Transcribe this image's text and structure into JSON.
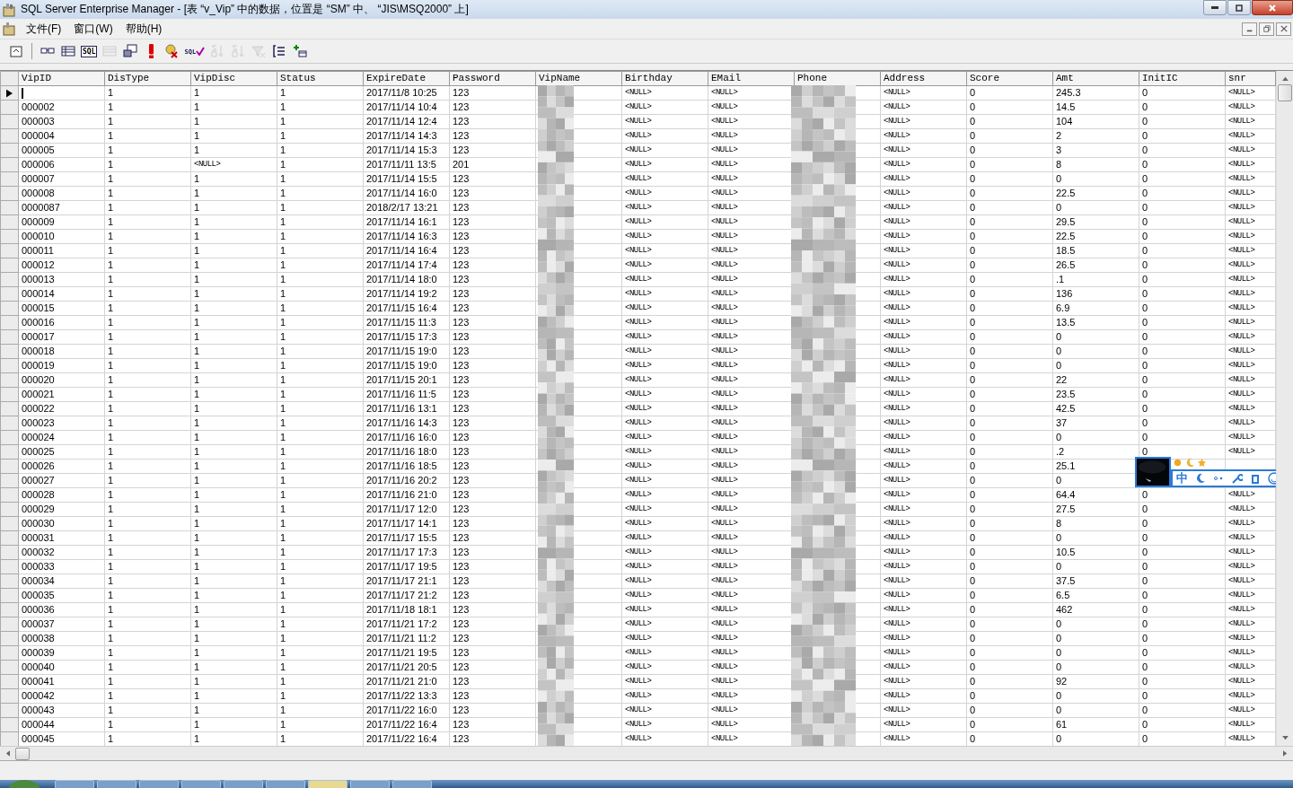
{
  "window": {
    "title": "SQL Server Enterprise Manager - [表 “v_Vip” 中的数据，位置是 “SM” 中、 “JIS\\MSQ2000” 上]"
  },
  "menu": [
    "文件(F)",
    "窗口(W)",
    "帮助(H)"
  ],
  "toolbar": [
    {
      "kind": "properties",
      "disabled": false
    },
    {
      "kind": "separator"
    },
    {
      "kind": "diagram",
      "disabled": false
    },
    {
      "kind": "grid",
      "disabled": false
    },
    {
      "kind": "sql",
      "text": "SQL",
      "disabled": false
    },
    {
      "kind": "results",
      "disabled": true
    },
    {
      "kind": "change-type",
      "disabled": false
    },
    {
      "kind": "run",
      "disabled": false
    },
    {
      "kind": "cancel",
      "disabled": false
    },
    {
      "kind": "verify",
      "text": "SQL",
      "disabled": false
    },
    {
      "kind": "sort-asc",
      "disabled": true
    },
    {
      "kind": "sort-desc",
      "disabled": true
    },
    {
      "kind": "remove-filter",
      "disabled": true
    },
    {
      "kind": "group-by",
      "disabled": false
    },
    {
      "kind": "add-table",
      "disabled": false
    }
  ],
  "table": {
    "columns": [
      "VipID",
      "DisType",
      "VipDisc",
      "Status",
      "ExpireDate",
      "Password",
      "VipName",
      "Birthday",
      "EMail",
      "Phone",
      "Address",
      "Score",
      "Amt",
      "InitIC",
      "snr"
    ],
    "rows": [
      {
        "current": true,
        "cells": [
          null,
          "1",
          "1",
          "1",
          "2017/11/8 10:25",
          "123",
          null,
          "<NULL>",
          "<NULL>",
          null,
          "<NULL>",
          "0",
          "245.3",
          "0",
          "<NULL>"
        ]
      },
      {
        "current": false,
        "cells": [
          "000002",
          "1",
          "1",
          "1",
          "2017/11/14 10:4",
          "123",
          null,
          "<NULL>",
          "<NULL>",
          null,
          "<NULL>",
          "0",
          "14.5",
          "0",
          "<NULL>"
        ]
      },
      {
        "current": false,
        "cells": [
          "000003",
          "1",
          "1",
          "1",
          "2017/11/14 12:4",
          "123",
          null,
          "<NULL>",
          "<NULL>",
          null,
          "<NULL>",
          "0",
          "104",
          "0",
          "<NULL>"
        ]
      },
      {
        "current": false,
        "cells": [
          "000004",
          "1",
          "1",
          "1",
          "2017/11/14 14:3",
          "123",
          null,
          "<NULL>",
          "<NULL>",
          null,
          "<NULL>",
          "0",
          "2",
          "0",
          "<NULL>"
        ]
      },
      {
        "current": false,
        "cells": [
          "000005",
          "1",
          "1",
          "1",
          "2017/11/14 15:3",
          "123",
          null,
          "<NULL>",
          "<NULL>",
          null,
          "<NULL>",
          "0",
          "3",
          "0",
          "<NULL>"
        ]
      },
      {
        "current": false,
        "cells": [
          "000006",
          "1",
          "<NULL>",
          "1",
          "2017/11/11 13:5",
          "201",
          null,
          "<NULL>",
          "<NULL>",
          null,
          "<NULL>",
          "0",
          "8",
          "0",
          "<NULL>"
        ]
      },
      {
        "current": false,
        "cells": [
          "000007",
          "1",
          "1",
          "1",
          "2017/11/14 15:5",
          "123",
          null,
          "<NULL>",
          "<NULL>",
          null,
          "<NULL>",
          "0",
          "0",
          "0",
          "<NULL>"
        ]
      },
      {
        "current": false,
        "cells": [
          "000008",
          "1",
          "1",
          "1",
          "2017/11/14 16:0",
          "123",
          null,
          "<NULL>",
          "<NULL>",
          null,
          "<NULL>",
          "0",
          "22.5",
          "0",
          "<NULL>"
        ]
      },
      {
        "current": false,
        "cells": [
          "0000087",
          "1",
          "1",
          "1",
          "2018/2/17 13:21",
          "123",
          null,
          "<NULL>",
          "<NULL>",
          null,
          "<NULL>",
          "0",
          "0",
          "0",
          "<NULL>"
        ]
      },
      {
        "current": false,
        "cells": [
          "000009",
          "1",
          "1",
          "1",
          "2017/11/14 16:1",
          "123",
          null,
          "<NULL>",
          "<NULL>",
          null,
          "<NULL>",
          "0",
          "29.5",
          "0",
          "<NULL>"
        ]
      },
      {
        "current": false,
        "cells": [
          "000010",
          "1",
          "1",
          "1",
          "2017/11/14 16:3",
          "123",
          null,
          "<NULL>",
          "<NULL>",
          null,
          "<NULL>",
          "0",
          "22.5",
          "0",
          "<NULL>"
        ]
      },
      {
        "current": false,
        "cells": [
          "000011",
          "1",
          "1",
          "1",
          "2017/11/14 16:4",
          "123",
          null,
          "<NULL>",
          "<NULL>",
          null,
          "<NULL>",
          "0",
          "18.5",
          "0",
          "<NULL>"
        ]
      },
      {
        "current": false,
        "cells": [
          "000012",
          "1",
          "1",
          "1",
          "2017/11/14 17:4",
          "123",
          null,
          "<NULL>",
          "<NULL>",
          null,
          "<NULL>",
          "0",
          "26.5",
          "0",
          "<NULL>"
        ]
      },
      {
        "current": false,
        "cells": [
          "000013",
          "1",
          "1",
          "1",
          "2017/11/14 18:0",
          "123",
          null,
          "<NULL>",
          "<NULL>",
          null,
          "<NULL>",
          "0",
          ".1",
          "0",
          "<NULL>"
        ]
      },
      {
        "current": false,
        "cells": [
          "000014",
          "1",
          "1",
          "1",
          "2017/11/14 19:2",
          "123",
          null,
          "<NULL>",
          "<NULL>",
          null,
          "<NULL>",
          "0",
          "136",
          "0",
          "<NULL>"
        ]
      },
      {
        "current": false,
        "cells": [
          "000015",
          "1",
          "1",
          "1",
          "2017/11/15 16:4",
          "123",
          null,
          "<NULL>",
          "<NULL>",
          null,
          "<NULL>",
          "0",
          "6.9",
          "0",
          "<NULL>"
        ]
      },
      {
        "current": false,
        "cells": [
          "000016",
          "1",
          "1",
          "1",
          "2017/11/15 11:3",
          "123",
          null,
          "<NULL>",
          "<NULL>",
          null,
          "<NULL>",
          "0",
          "13.5",
          "0",
          "<NULL>"
        ]
      },
      {
        "current": false,
        "cells": [
          "000017",
          "1",
          "1",
          "1",
          "2017/11/15 17:3",
          "123",
          null,
          "<NULL>",
          "<NULL>",
          null,
          "<NULL>",
          "0",
          "0",
          "0",
          "<NULL>"
        ]
      },
      {
        "current": false,
        "cells": [
          "000018",
          "1",
          "1",
          "1",
          "2017/11/15 19:0",
          "123",
          null,
          "<NULL>",
          "<NULL>",
          null,
          "<NULL>",
          "0",
          "0",
          "0",
          "<NULL>"
        ]
      },
      {
        "current": false,
        "cells": [
          "000019",
          "1",
          "1",
          "1",
          "2017/11/15 19:0",
          "123",
          null,
          "<NULL>",
          "<NULL>",
          null,
          "<NULL>",
          "0",
          "0",
          "0",
          "<NULL>"
        ]
      },
      {
        "current": false,
        "cells": [
          "000020",
          "1",
          "1",
          "1",
          "2017/11/15 20:1",
          "123",
          null,
          "<NULL>",
          "<NULL>",
          null,
          "<NULL>",
          "0",
          "22",
          "0",
          "<NULL>"
        ]
      },
      {
        "current": false,
        "cells": [
          "000021",
          "1",
          "1",
          "1",
          "2017/11/16 11:5",
          "123",
          null,
          "<NULL>",
          "<NULL>",
          null,
          "<NULL>",
          "0",
          "23.5",
          "0",
          "<NULL>"
        ]
      },
      {
        "current": false,
        "cells": [
          "000022",
          "1",
          "1",
          "1",
          "2017/11/16 13:1",
          "123",
          null,
          "<NULL>",
          "<NULL>",
          null,
          "<NULL>",
          "0",
          "42.5",
          "0",
          "<NULL>"
        ]
      },
      {
        "current": false,
        "cells": [
          "000023",
          "1",
          "1",
          "1",
          "2017/11/16 14:3",
          "123",
          null,
          "<NULL>",
          "<NULL>",
          null,
          "<NULL>",
          "0",
          "37",
          "0",
          "<NULL>"
        ]
      },
      {
        "current": false,
        "cells": [
          "000024",
          "1",
          "1",
          "1",
          "2017/11/16 16:0",
          "123",
          null,
          "<NULL>",
          "<NULL>",
          null,
          "<NULL>",
          "0",
          "0",
          "0",
          "<NULL>"
        ]
      },
      {
        "current": false,
        "cells": [
          "000025",
          "1",
          "1",
          "1",
          "2017/11/16 18:0",
          "123",
          null,
          "<NULL>",
          "<NULL>",
          null,
          "<NULL>",
          "0",
          ".2",
          "0",
          "<NULL>"
        ]
      },
      {
        "current": false,
        "cells": [
          "000026",
          "1",
          "1",
          "1",
          "2017/11/16 18:5",
          "123",
          null,
          "<NULL>",
          "<NULL>",
          null,
          "<NULL>",
          "0",
          "25.1",
          null,
          null
        ]
      },
      {
        "current": false,
        "cells": [
          "000027",
          "1",
          "1",
          "1",
          "2017/11/16 20:2",
          "123",
          null,
          "<NULL>",
          "<NULL>",
          null,
          "<NULL>",
          "0",
          "0",
          null,
          null
        ]
      },
      {
        "current": false,
        "cells": [
          "000028",
          "1",
          "1",
          "1",
          "2017/11/16 21:0",
          "123",
          null,
          "<NULL>",
          "<NULL>",
          null,
          "<NULL>",
          "0",
          "64.4",
          "0",
          "<NULL>"
        ]
      },
      {
        "current": false,
        "cells": [
          "000029",
          "1",
          "1",
          "1",
          "2017/11/17 12:0",
          "123",
          null,
          "<NULL>",
          "<NULL>",
          null,
          "<NULL>",
          "0",
          "27.5",
          "0",
          "<NULL>"
        ]
      },
      {
        "current": false,
        "cells": [
          "000030",
          "1",
          "1",
          "1",
          "2017/11/17 14:1",
          "123",
          null,
          "<NULL>",
          "<NULL>",
          null,
          "<NULL>",
          "0",
          "8",
          "0",
          "<NULL>"
        ]
      },
      {
        "current": false,
        "cells": [
          "000031",
          "1",
          "1",
          "1",
          "2017/11/17 15:5",
          "123",
          null,
          "<NULL>",
          "<NULL>",
          null,
          "<NULL>",
          "0",
          "0",
          "0",
          "<NULL>"
        ]
      },
      {
        "current": false,
        "cells": [
          "000032",
          "1",
          "1",
          "1",
          "2017/11/17 17:3",
          "123",
          null,
          "<NULL>",
          "<NULL>",
          null,
          "<NULL>",
          "0",
          "10.5",
          "0",
          "<NULL>"
        ]
      },
      {
        "current": false,
        "cells": [
          "000033",
          "1",
          "1",
          "1",
          "2017/11/17 19:5",
          "123",
          null,
          "<NULL>",
          "<NULL>",
          null,
          "<NULL>",
          "0",
          "0",
          "0",
          "<NULL>"
        ]
      },
      {
        "current": false,
        "cells": [
          "000034",
          "1",
          "1",
          "1",
          "2017/11/17 21:1",
          "123",
          null,
          "<NULL>",
          "<NULL>",
          null,
          "<NULL>",
          "0",
          "37.5",
          "0",
          "<NULL>"
        ]
      },
      {
        "current": false,
        "cells": [
          "000035",
          "1",
          "1",
          "1",
          "2017/11/17 21:2",
          "123",
          null,
          "<NULL>",
          "<NULL>",
          null,
          "<NULL>",
          "0",
          "6.5",
          "0",
          "<NULL>"
        ]
      },
      {
        "current": false,
        "cells": [
          "000036",
          "1",
          "1",
          "1",
          "2017/11/18 18:1",
          "123",
          null,
          "<NULL>",
          "<NULL>",
          null,
          "<NULL>",
          "0",
          "462",
          "0",
          "<NULL>"
        ]
      },
      {
        "current": false,
        "cells": [
          "000037",
          "1",
          "1",
          "1",
          "2017/11/21 17:2",
          "123",
          null,
          "<NULL>",
          "<NULL>",
          null,
          "<NULL>",
          "0",
          "0",
          "0",
          "<NULL>"
        ]
      },
      {
        "current": false,
        "cells": [
          "000038",
          "1",
          "1",
          "1",
          "2017/11/21 11:2",
          "123",
          null,
          "<NULL>",
          "<NULL>",
          null,
          "<NULL>",
          "0",
          "0",
          "0",
          "<NULL>"
        ]
      },
      {
        "current": false,
        "cells": [
          "000039",
          "1",
          "1",
          "1",
          "2017/11/21 19:5",
          "123",
          null,
          "<NULL>",
          "<NULL>",
          null,
          "<NULL>",
          "0",
          "0",
          "0",
          "<NULL>"
        ]
      },
      {
        "current": false,
        "cells": [
          "000040",
          "1",
          "1",
          "1",
          "2017/11/21 20:5",
          "123",
          null,
          "<NULL>",
          "<NULL>",
          null,
          "<NULL>",
          "0",
          "0",
          "0",
          "<NULL>"
        ]
      },
      {
        "current": false,
        "cells": [
          "000041",
          "1",
          "1",
          "1",
          "2017/11/21 21:0",
          "123",
          null,
          "<NULL>",
          "<NULL>",
          null,
          "<NULL>",
          "0",
          "92",
          "0",
          "<NULL>"
        ]
      },
      {
        "current": false,
        "cells": [
          "000042",
          "1",
          "1",
          "1",
          "2017/11/22 13:3",
          "123",
          null,
          "<NULL>",
          "<NULL>",
          null,
          "<NULL>",
          "0",
          "0",
          "0",
          "<NULL>"
        ]
      },
      {
        "current": false,
        "cells": [
          "000043",
          "1",
          "1",
          "1",
          "2017/11/22 16:0",
          "123",
          null,
          "<NULL>",
          "<NULL>",
          null,
          "<NULL>",
          "0",
          "0",
          "0",
          "<NULL>"
        ]
      },
      {
        "current": false,
        "cells": [
          "000044",
          "1",
          "1",
          "1",
          "2017/11/22 16:4",
          "123",
          null,
          "<NULL>",
          "<NULL>",
          null,
          "<NULL>",
          "0",
          "61",
          "0",
          "<NULL>"
        ]
      },
      {
        "current": false,
        "cells": [
          "000045",
          "1",
          "1",
          "1",
          "2017/11/22 16:4",
          "123",
          null,
          "<NULL>",
          "<NULL>",
          null,
          "<NULL>",
          "0",
          "0",
          "0",
          "<NULL>"
        ]
      }
    ]
  },
  "ime": {
    "mode": "中"
  }
}
